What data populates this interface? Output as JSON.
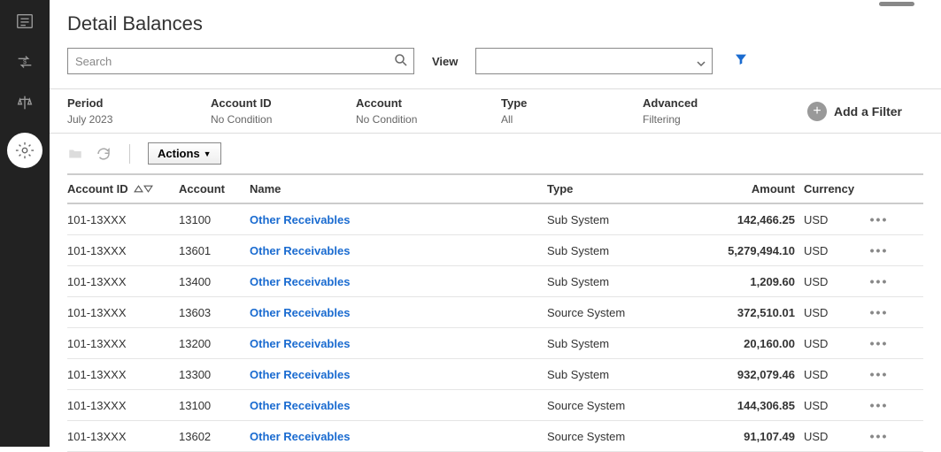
{
  "page_title": "Detail Balances",
  "search": {
    "placeholder": "Search"
  },
  "view": {
    "label": "View",
    "value": ""
  },
  "filters": {
    "period": {
      "label": "Period",
      "value": "July 2023"
    },
    "account_id": {
      "label": "Account ID",
      "value": "No Condition"
    },
    "account": {
      "label": "Account",
      "value": "No Condition"
    },
    "type": {
      "label": "Type",
      "value": "All"
    },
    "advanced": {
      "label": "Advanced",
      "value": "Filtering"
    },
    "add_filter": "Add a Filter"
  },
  "actions_button": "Actions",
  "columns": {
    "account_id": "Account ID",
    "account": "Account",
    "name": "Name",
    "type": "Type",
    "amount": "Amount",
    "currency": "Currency"
  },
  "rows": [
    {
      "account_id": "101-13XXX",
      "account": "13100",
      "name": "Other Receivables",
      "type": "Sub System",
      "amount": "142,466.25",
      "currency": "USD"
    },
    {
      "account_id": "101-13XXX",
      "account": "13601",
      "name": "Other Receivables",
      "type": "Sub System",
      "amount": "5,279,494.10",
      "currency": "USD"
    },
    {
      "account_id": "101-13XXX",
      "account": "13400",
      "name": "Other Receivables",
      "type": "Sub System",
      "amount": "1,209.60",
      "currency": "USD"
    },
    {
      "account_id": "101-13XXX",
      "account": "13603",
      "name": "Other Receivables",
      "type": "Source System",
      "amount": "372,510.01",
      "currency": "USD"
    },
    {
      "account_id": "101-13XXX",
      "account": "13200",
      "name": "Other Receivables",
      "type": "Sub System",
      "amount": "20,160.00",
      "currency": "USD"
    },
    {
      "account_id": "101-13XXX",
      "account": "13300",
      "name": "Other Receivables",
      "type": "Sub System",
      "amount": "932,079.46",
      "currency": "USD"
    },
    {
      "account_id": "101-13XXX",
      "account": "13100",
      "name": "Other Receivables",
      "type": "Source System",
      "amount": "144,306.85",
      "currency": "USD"
    },
    {
      "account_id": "101-13XXX",
      "account": "13602",
      "name": "Other Receivables",
      "type": "Source System",
      "amount": "91,107.49",
      "currency": "USD"
    }
  ]
}
